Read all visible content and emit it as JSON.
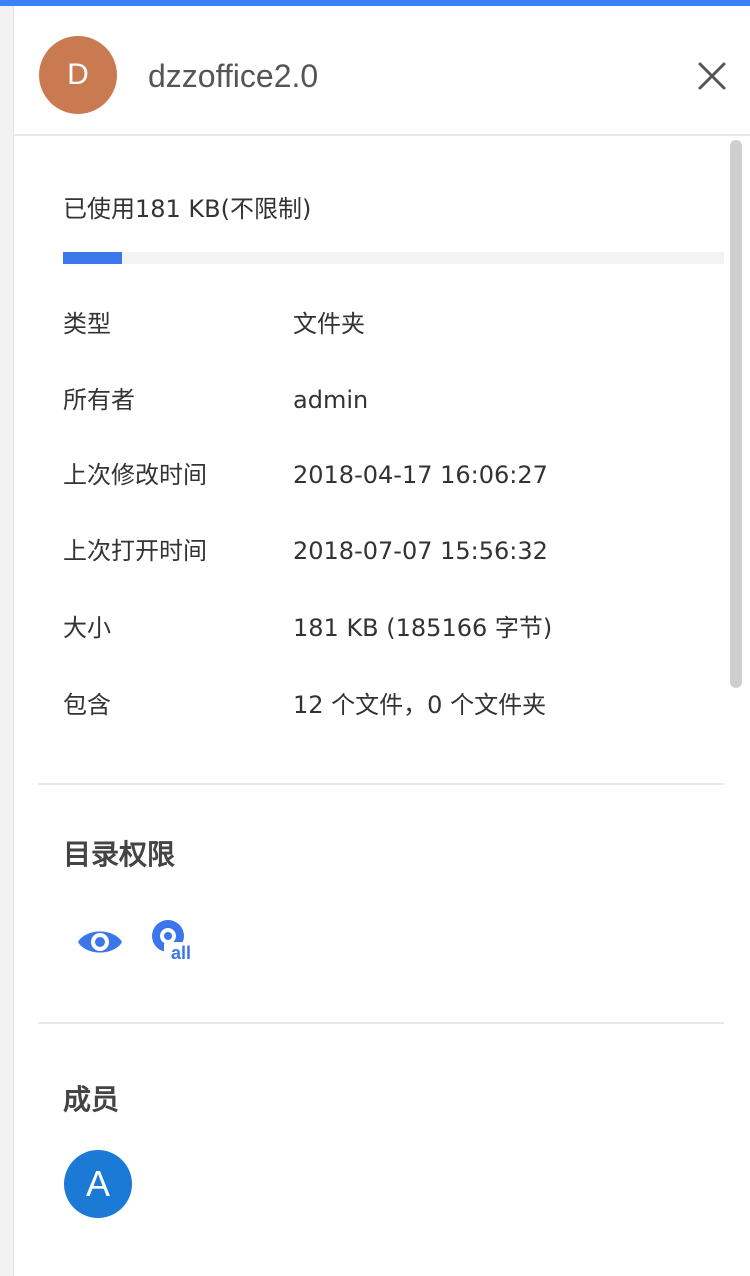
{
  "header": {
    "avatar_letter": "D",
    "avatar_color": "#c97a50",
    "title": "dzzoffice2.0"
  },
  "usage": {
    "text": "已使用181 KB(不限制)",
    "fraction": 0.09,
    "fill_color": "#3b76ea"
  },
  "info": {
    "type_label": "类型",
    "type_value": "文件夹",
    "owner_label": "所有者",
    "owner_value": "admin",
    "modified_label": "上次修改时间",
    "modified_value": "2018-04-17 16:06:27",
    "opened_label": "上次打开时间",
    "opened_value": "2018-07-07 15:56:32",
    "size_label": "大小",
    "size_value": "181 KB (185166 字节)",
    "contains_label": "包含",
    "contains_value": "12 个文件，0 个文件夹"
  },
  "permissions": {
    "title": "目录权限",
    "icons": [
      "eye-icon",
      "eye-all-icon"
    ],
    "icon_badge": "all",
    "icon_color": "#3b76ea"
  },
  "members": {
    "title": "成员",
    "avatar_letter": "A",
    "avatar_color": "#1a7ad6"
  },
  "accent_color": "#3b82f6"
}
